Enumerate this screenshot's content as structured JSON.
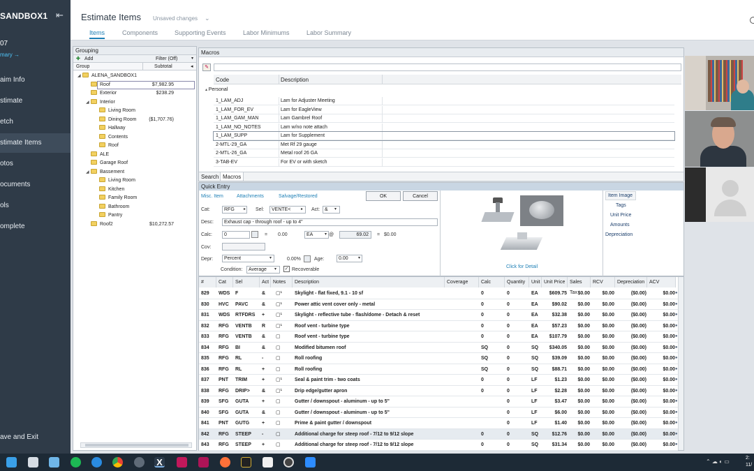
{
  "nav": {
    "title": "SANDBOX1",
    "number": "07",
    "summary_link": "mary →",
    "items": [
      {
        "label": "aim Info"
      },
      {
        "label": "stimate"
      },
      {
        "label": "etch"
      },
      {
        "label": "stimate Items"
      },
      {
        "label": "otos"
      },
      {
        "label": "ocuments"
      },
      {
        "label": "ols"
      },
      {
        "label": "omplete"
      }
    ],
    "save_exit": "ave and Exit"
  },
  "header": {
    "title": "Estimate Items",
    "unsaved": "Unsaved changes",
    "tabs": [
      "Items",
      "Components",
      "Supporting Events",
      "Labor Minimums",
      "Labor Summary"
    ]
  },
  "grouping": {
    "title": "Grouping",
    "add": "Add",
    "filter": "Filter (Off)",
    "col_group": "Group",
    "col_subtotal": "Subtotal",
    "tree": [
      {
        "label": "ALENA_SANDBOX1",
        "amount": "",
        "depth": 0,
        "exp": "◢"
      },
      {
        "label": "Roof",
        "amount": "$7,982.95",
        "depth": 1,
        "exp": ""
      },
      {
        "label": "Exterior",
        "amount": "$238.29",
        "depth": 1,
        "exp": ""
      },
      {
        "label": "Interior",
        "amount": "",
        "depth": 1,
        "exp": "◢"
      },
      {
        "label": "Living Room",
        "amount": "",
        "depth": 2,
        "exp": ""
      },
      {
        "label": "Dining Room",
        "amount": "($1,707.76)",
        "depth": 2,
        "exp": ""
      },
      {
        "label": "Hallway",
        "amount": "",
        "depth": 2,
        "exp": ""
      },
      {
        "label": "Contents",
        "amount": "",
        "depth": 2,
        "exp": ""
      },
      {
        "label": "Roof",
        "amount": "",
        "depth": 2,
        "exp": ""
      },
      {
        "label": "ALE",
        "amount": "",
        "depth": 1,
        "exp": ""
      },
      {
        "label": "Garage Roof",
        "amount": "",
        "depth": 1,
        "exp": ""
      },
      {
        "label": "Bassement",
        "amount": "",
        "depth": 1,
        "exp": "◢"
      },
      {
        "label": "Living Room",
        "amount": "",
        "depth": 2,
        "exp": ""
      },
      {
        "label": "Kitchen",
        "amount": "",
        "depth": 2,
        "exp": ""
      },
      {
        "label": "Family Room",
        "amount": "",
        "depth": 2,
        "exp": ""
      },
      {
        "label": "Bathroom",
        "amount": "",
        "depth": 2,
        "exp": ""
      },
      {
        "label": "Pantry",
        "amount": "",
        "depth": 2,
        "exp": ""
      },
      {
        "label": "Roof2",
        "amount": "$10,272.57",
        "depth": 1,
        "exp": ""
      }
    ]
  },
  "macros": {
    "title": "Macros",
    "col_code": "Code",
    "col_desc": "Description",
    "section": "Personal",
    "rows": [
      {
        "code": "1_LAM_ADJ",
        "desc": "Lam for Adjuster Meeting"
      },
      {
        "code": "1_LAM_FOR_EV",
        "desc": "Lam for EagleView"
      },
      {
        "code": "1_LAM_GAM_MAN",
        "desc": "Lam Gambrel Roof"
      },
      {
        "code": "1_LAM_NO_NOTES",
        "desc": "Lam w/no note attach"
      },
      {
        "code": "1_LAM_SUPP",
        "desc": "Lam for Supplement"
      },
      {
        "code": "2-MTL-29_GA",
        "desc": "Met Rf 29 gauge"
      },
      {
        "code": "2-MTL-26_GA",
        "desc": "Metal roof 26 GA"
      },
      {
        "code": "3-TAB-EV",
        "desc": "For EV or with sketch"
      }
    ],
    "bottom_tabs": [
      "Search",
      "Macros"
    ]
  },
  "quick_entry": {
    "title": "Quick Entry",
    "tabs": [
      "Misc. Item",
      "Attachments",
      "Salvage/Restored"
    ],
    "ok": "OK",
    "cancel": "Cancel",
    "cat_label": "Cat:",
    "cat": "RFG",
    "sel_label": "Sel:",
    "sel": "VENTE<",
    "act_label": "Act:",
    "act": "&",
    "desc_label": "Desc:",
    "desc": "Exhaust cap - through roof - up to 4\"",
    "calc_label": "Calc:",
    "calc": "0",
    "eq1": "=",
    "qty": "0.00",
    "unit": "EA",
    "at": "@",
    "price": "69.02",
    "eq2": "=",
    "total": "$0.00",
    "cov_label": "Cov:",
    "depr_label": "Depr:",
    "depr": "Percent",
    "depr_pct": "0.00%",
    "age_label": "Age:",
    "age": "0.00",
    "cond_label": "Condition:",
    "cond": "Average",
    "recoverable": "Recoverable",
    "click_detail": "Click for Detail",
    "side_tabs": [
      "Item Image",
      "Tags",
      "Unit Price",
      "Amounts",
      "Depreciation"
    ]
  },
  "items": {
    "columns": [
      "#",
      "Cat",
      "Sel",
      "Act",
      "Notes",
      "Description",
      "Coverage",
      "Calc",
      "Quantity",
      "Unit",
      "Unit Price",
      "Sales Tax",
      "RCV",
      "Depreciation",
      "ACV"
    ],
    "rows": [
      {
        "n": "829",
        "cat": "WDS",
        "sel": "F",
        "act": "&",
        "desc": "Skylight - flat fixed, 9.1 - 10 sf",
        "calc": "0",
        "qty": "0",
        "unit": "EA",
        "price": "$609.75",
        "tax": "$0.00",
        "rcv": "$0.00",
        "dep": "($0.00)",
        "acv": "$0.00"
      },
      {
        "n": "830",
        "cat": "HVC",
        "sel": "PAVC",
        "act": "&",
        "desc": "Power attic vent cover only - metal",
        "calc": "0",
        "qty": "0",
        "unit": "EA",
        "price": "$90.02",
        "tax": "$0.00",
        "rcv": "$0.00",
        "dep": "($0.00)",
        "acv": "$0.00"
      },
      {
        "n": "831",
        "cat": "WDS",
        "sel": "RTFDRS",
        "act": "+",
        "desc": "Skylight - reflective tube - flash/dome - Detach & reset",
        "calc": "0",
        "qty": "0",
        "unit": "EA",
        "price": "$32.38",
        "tax": "$0.00",
        "rcv": "$0.00",
        "dep": "($0.00)",
        "acv": "$0.00"
      },
      {
        "n": "832",
        "cat": "RFG",
        "sel": "VENTB",
        "act": "R",
        "desc": "Roof vent - turbine type",
        "calc": "0",
        "qty": "0",
        "unit": "EA",
        "price": "$57.23",
        "tax": "$0.00",
        "rcv": "$0.00",
        "dep": "($0.00)",
        "acv": "$0.00"
      },
      {
        "n": "833",
        "cat": "RFG",
        "sel": "VENTB",
        "act": "&",
        "desc": "Roof vent - turbine type",
        "calc": "0",
        "qty": "0",
        "unit": "EA",
        "price": "$107.79",
        "tax": "$0.00",
        "rcv": "$0.00",
        "dep": "($0.00)",
        "acv": "$0.00"
      },
      {
        "n": "834",
        "cat": "RFG",
        "sel": "BI",
        "act": "&",
        "desc": "Modified bitumen roof",
        "calc": "SQ",
        "qty": "0",
        "unit": "SQ",
        "price": "$340.05",
        "tax": "$0.00",
        "rcv": "$0.00",
        "dep": "($0.00)",
        "acv": "$0.00"
      },
      {
        "n": "835",
        "cat": "RFG",
        "sel": "RL",
        "act": "-",
        "desc": "Roll roofing",
        "calc": "SQ",
        "qty": "0",
        "unit": "SQ",
        "price": "$39.09",
        "tax": "$0.00",
        "rcv": "$0.00",
        "dep": "($0.00)",
        "acv": "$0.00"
      },
      {
        "n": "836",
        "cat": "RFG",
        "sel": "RL",
        "act": "+",
        "desc": "Roll roofing",
        "calc": "SQ",
        "qty": "0",
        "unit": "SQ",
        "price": "$88.71",
        "tax": "$0.00",
        "rcv": "$0.00",
        "dep": "($0.00)",
        "acv": "$0.00"
      },
      {
        "n": "837",
        "cat": "PNT",
        "sel": "TRIM",
        "act": "+",
        "desc": "Seal & paint trim - two coats",
        "calc": "0",
        "qty": "0",
        "unit": "LF",
        "price": "$1.23",
        "tax": "$0.00",
        "rcv": "$0.00",
        "dep": "($0.00)",
        "acv": "$0.00"
      },
      {
        "n": "838",
        "cat": "RFG",
        "sel": "DRIP>",
        "act": "&",
        "desc": "Drip edge/gutter apron",
        "calc": "0",
        "qty": "0",
        "unit": "LF",
        "price": "$2.28",
        "tax": "$0.00",
        "rcv": "$0.00",
        "dep": "($0.00)",
        "acv": "$0.00"
      },
      {
        "n": "839",
        "cat": "SFG",
        "sel": "GUTA",
        "act": "+",
        "desc": "Gutter / downspout - aluminum - up to 5\"",
        "calc": "",
        "qty": "0",
        "unit": "LF",
        "price": "$3.47",
        "tax": "$0.00",
        "rcv": "$0.00",
        "dep": "($0.00)",
        "acv": "$0.00"
      },
      {
        "n": "840",
        "cat": "SFG",
        "sel": "GUTA",
        "act": "&",
        "desc": "Gutter / downspout - aluminum - up to 5\"",
        "calc": "",
        "qty": "0",
        "unit": "LF",
        "price": "$6.00",
        "tax": "$0.00",
        "rcv": "$0.00",
        "dep": "($0.00)",
        "acv": "$0.00"
      },
      {
        "n": "841",
        "cat": "PNT",
        "sel": "GUTG",
        "act": "+",
        "desc": "Prime & paint gutter / downspout",
        "calc": "",
        "qty": "0",
        "unit": "LF",
        "price": "$1.40",
        "tax": "$0.00",
        "rcv": "$0.00",
        "dep": "($0.00)",
        "acv": "$0.00"
      },
      {
        "n": "842",
        "cat": "RFG",
        "sel": "STEEP",
        "act": "-",
        "desc": "Additional charge for steep roof - 7/12 to 9/12 slope",
        "calc": "0",
        "qty": "0",
        "unit": "SQ",
        "price": "$12.76",
        "tax": "$0.00",
        "rcv": "$0.00",
        "dep": "($0.00)",
        "acv": "$0.00"
      },
      {
        "n": "843",
        "cat": "RFG",
        "sel": "STEEP",
        "act": "+",
        "desc": "Additional charge for steep roof - 7/12 to 9/12 slope",
        "calc": "0",
        "qty": "0",
        "unit": "SQ",
        "price": "$31.34",
        "tax": "$0.00",
        "rcv": "$0.00",
        "dep": "($0.00)",
        "acv": "$0.00"
      }
    ]
  },
  "taskbar": {
    "clock": "2:",
    "date": "11/"
  }
}
